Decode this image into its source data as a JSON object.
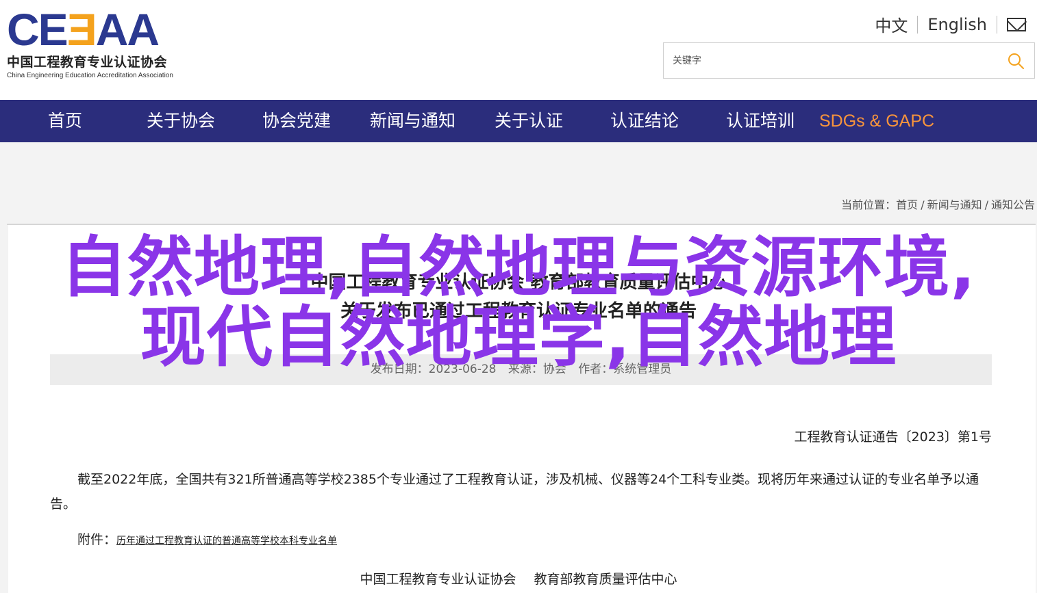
{
  "logo": {
    "mark_left": "CE",
    "mark_mid": "Ǝ",
    "mark_right": "AA",
    "name_cn": "中国工程教育专业认证协会",
    "name_en": "China Engineering Education Accreditation Association"
  },
  "lang": {
    "cn": "中文",
    "en": "English",
    "mail_icon": "mail-icon"
  },
  "search": {
    "placeholder": "关键字",
    "value": "",
    "icon": "search-icon"
  },
  "nav": {
    "items": [
      {
        "label": "首页"
      },
      {
        "label": "关于协会"
      },
      {
        "label": "协会党建"
      },
      {
        "label": "新闻与通知"
      },
      {
        "label": "关于认证"
      },
      {
        "label": "认证结论"
      },
      {
        "label": "认证培训"
      },
      {
        "label": "SDGs & GAPC"
      }
    ]
  },
  "breadcrumb": {
    "prefix": "当前位置：",
    "items": [
      "首页",
      "新闻与通知",
      "通知公告"
    ]
  },
  "article": {
    "title_line1": "中国工程教育专业认证协会 教育部教育质量评估中心",
    "title_line2": "关于发布已通过工程教育认证专业名单的通告",
    "meta_date": "发布日期：2023-06-28",
    "meta_source": "来源：协会",
    "meta_author": "作者：系统管理员",
    "doc_no": "工程教育认证通告〔2023〕第1号",
    "paragraph": "截至2022年底，全国共有321所普通高等学校2385个专业通过了工程教育认证，涉及机械、仪器等24个工科专业类。现将历年来通过认证的专业名单予以通告。",
    "attach_label": "附件：",
    "attach_link": "历年通过工程教育认证的普通高等学校本科专业名单",
    "sign1": "中国工程教育专业认证协会",
    "sign2": "教育部教育质量评估中心"
  },
  "overlay": {
    "line1": "自然地理,自然地理与资源环境,",
    "line2": "现代自然地理学,自然地理"
  },
  "colors": {
    "nav_bg": "#2b2d7c",
    "nav_highlight": "#f7943c",
    "logo_blue": "#2b3990",
    "logo_orange": "#f4a21d",
    "overlay_text": "#8a35e8",
    "search_icon": "#f4a21d"
  }
}
